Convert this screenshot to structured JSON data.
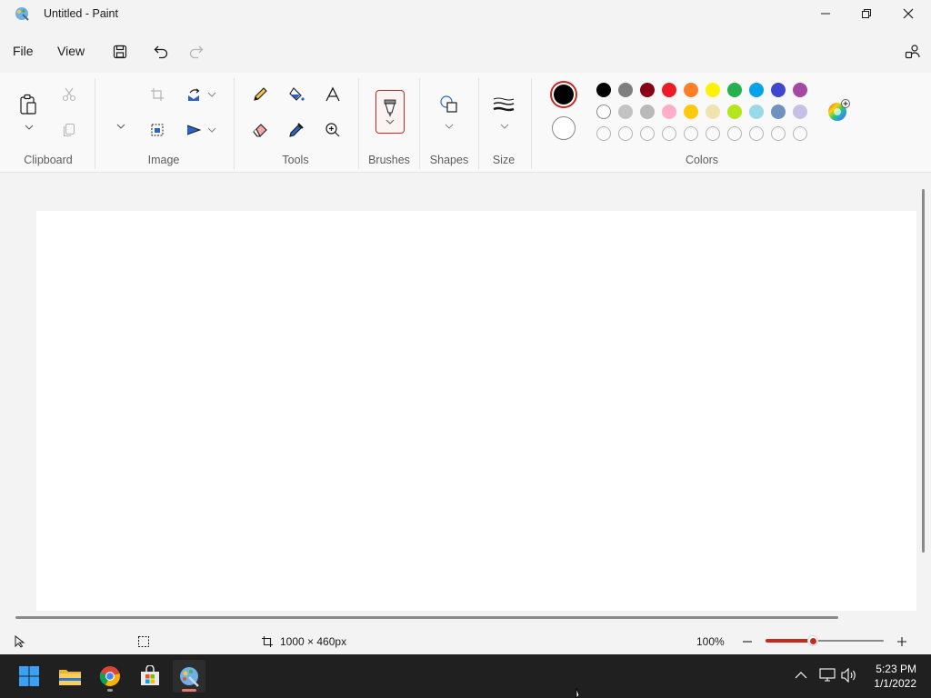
{
  "window": {
    "title": "Untitled - Paint"
  },
  "menu": {
    "file": "File",
    "view": "View"
  },
  "ribbon": {
    "groups": {
      "clipboard": "Clipboard",
      "image": "Image",
      "tools": "Tools",
      "brushes": "Brushes",
      "shapes": "Shapes",
      "size": "Size",
      "colors": "Colors"
    }
  },
  "colors": {
    "primary": "#000000",
    "secondary": "#ffffff",
    "row1": [
      "#000000",
      "#7f7f7f",
      "#880015",
      "#ed1c24",
      "#ff7f27",
      "#fff200",
      "#22b14c",
      "#00a2e8",
      "#3f48cc",
      "#a349a4"
    ],
    "row2": [
      "#ffffff",
      "#c3c3c3",
      "#b9b9b9",
      "#ffaec9",
      "#ffc90e",
      "#efe4b0",
      "#b5e61d",
      "#99d9ea",
      "#7092be",
      "#c8bfe7"
    ],
    "accent": "#c42b1c"
  },
  "status": {
    "canvas_size": "1000 × 460px",
    "zoom": "100%",
    "zoom_level": 0.4
  },
  "taskbar": {
    "time": "5:23 PM",
    "date": "1/1/2022"
  }
}
